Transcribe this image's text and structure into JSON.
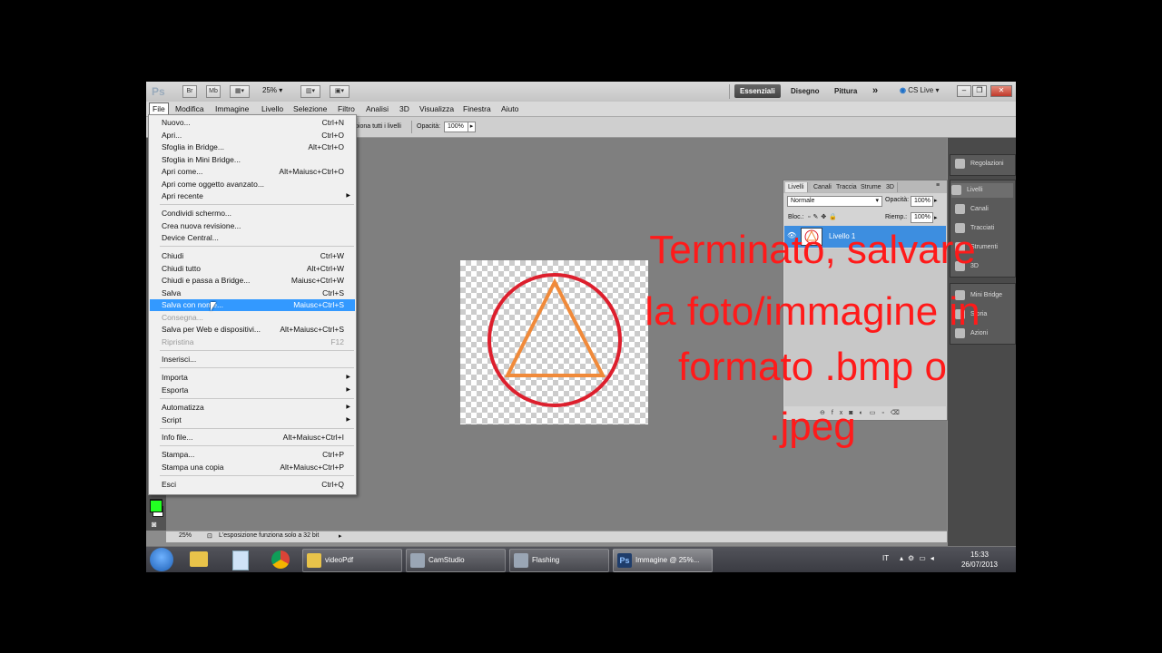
{
  "app": {
    "logo": "Ps",
    "quick_btns": [
      "Br",
      "Mb"
    ],
    "zoom": "25%",
    "workspaces": [
      "Essenziali",
      "Disegno",
      "Pittura"
    ],
    "more": "»",
    "cslive": "CS Live"
  },
  "menubar": [
    "File",
    "Modifica",
    "Immagine",
    "Livello",
    "Selezione",
    "Filtro",
    "Analisi",
    "3D",
    "Visualizza",
    "Finestra",
    "Aiuto"
  ],
  "options": {
    "sample_text": "pionа tutti i livelli",
    "opacity_label": "Opacità:",
    "opacity_value": "100%"
  },
  "file_menu": [
    {
      "label": "Nuovo...",
      "shortcut": "Ctrl+N"
    },
    {
      "label": "Apri...",
      "shortcut": "Ctrl+O"
    },
    {
      "label": "Sfoglia in Bridge...",
      "shortcut": "Alt+Ctrl+O"
    },
    {
      "label": "Sfoglia in Mini Bridge...",
      "shortcut": ""
    },
    {
      "label": "Apri come...",
      "shortcut": "Alt+Maiusc+Ctrl+O"
    },
    {
      "label": "Apri come oggetto avanzato...",
      "shortcut": ""
    },
    {
      "label": "Apri recente",
      "shortcut": "",
      "submenu": true
    },
    {
      "label": "Condividi schermo...",
      "shortcut": ""
    },
    {
      "label": "Crea nuova revisione...",
      "shortcut": ""
    },
    {
      "label": "Device Central...",
      "shortcut": ""
    },
    {
      "label": "Chiudi",
      "shortcut": "Ctrl+W"
    },
    {
      "label": "Chiudi tutto",
      "shortcut": "Alt+Ctrl+W"
    },
    {
      "label": "Chiudi e passa a Bridge...",
      "shortcut": "Maiusc+Ctrl+W"
    },
    {
      "label": "Salva",
      "shortcut": "Ctrl+S"
    },
    {
      "label": "Salva con nome...",
      "shortcut": "Maiusc+Ctrl+S",
      "highlighted": true
    },
    {
      "label": "Consegna...",
      "shortcut": "",
      "disabled": true
    },
    {
      "label": "Salva per Web e dispositivi...",
      "shortcut": "Alt+Maiusc+Ctrl+S"
    },
    {
      "label": "Ripristina",
      "shortcut": "F12",
      "disabled": true
    },
    {
      "label": "Inserisci...",
      "shortcut": ""
    },
    {
      "label": "Importa",
      "shortcut": "",
      "submenu": true
    },
    {
      "label": "Esporta",
      "shortcut": "",
      "submenu": true
    },
    {
      "label": "Automatizza",
      "shortcut": "",
      "submenu": true
    },
    {
      "label": "Script",
      "shortcut": "",
      "submenu": true
    },
    {
      "label": "Info file...",
      "shortcut": "Alt+Maiusc+Ctrl+I"
    },
    {
      "label": "Stampa...",
      "shortcut": "Ctrl+P"
    },
    {
      "label": "Stampa una copia",
      "shortcut": "Alt+Maiusc+Ctrl+P"
    },
    {
      "label": "Esci",
      "shortcut": "Ctrl+Q"
    }
  ],
  "layers_panel": {
    "tabs": [
      "Livelli",
      "Canali",
      "Traccia",
      "Strume",
      "3D"
    ],
    "blend_mode": "Normale",
    "opacity_label": "Opacità:",
    "opacity_value": "100%",
    "lock_label": "Bloc.:",
    "fill_label": "Riemp.:",
    "fill_value": "100%",
    "layer_name": "Livello 1"
  },
  "dock": [
    "Regolazioni",
    "Livelli",
    "Canali",
    "Tracciati",
    "Strumenti",
    "3D",
    "Mini Bridge",
    "Storia",
    "Azioni"
  ],
  "status": {
    "zoom": "25%",
    "text": "L'esposizione funziona solo a 32 bit"
  },
  "caption": {
    "lines": [
      "Terminato, salvare",
      "la foto/immagine in",
      "formato .bmp o",
      ".jpeg"
    ],
    "color": "#ff1a1a"
  },
  "taskbar": {
    "tasks": [
      "videoPdf",
      "CamStudio",
      "Flashing",
      "Immagine @ 25%..."
    ],
    "lang": "IT",
    "time": "15:33",
    "date": "26/07/2013"
  },
  "colors": {
    "selection": "#3399ff",
    "layer_selected": "#3d8ee0",
    "circle": "#dd1f2d",
    "triangle": "#f08a3a",
    "foreground_swatch": "#22ff22"
  }
}
